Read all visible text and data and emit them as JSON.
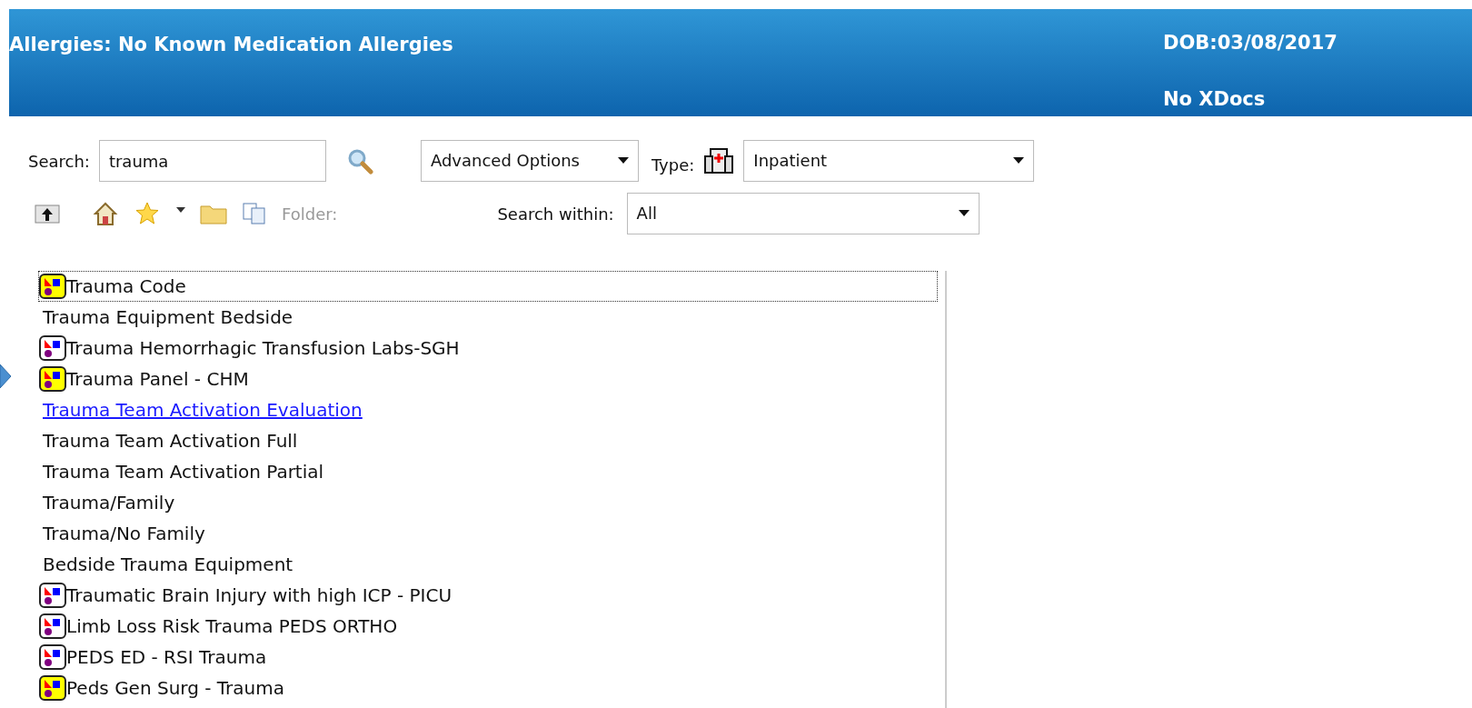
{
  "header": {
    "allergies": "Allergies: No Known Medication Allergies",
    "dob": "DOB:03/08/2017",
    "xdocs": "No XDocs"
  },
  "search": {
    "label": "Search:",
    "value": "trauma",
    "advanced": "Advanced Options",
    "type_label": "Type:",
    "type_value": "Inpatient"
  },
  "toolbar": {
    "folder_label": "Folder:",
    "search_within_label": "Search within:",
    "search_within_value": "All"
  },
  "results": [
    {
      "label": "Trauma Code",
      "kind": "plan_yellow",
      "selected": true,
      "hovered": false
    },
    {
      "label": "Trauma Equipment Bedside",
      "kind": "none",
      "selected": false,
      "hovered": false
    },
    {
      "label": "Trauma Hemorrhagic Transfusion Labs-SGH",
      "kind": "plan_white",
      "selected": false,
      "hovered": false
    },
    {
      "label": "Trauma Panel - CHM",
      "kind": "plan_yellow",
      "selected": false,
      "hovered": false
    },
    {
      "label": "Trauma Team Activation Evaluation",
      "kind": "none",
      "selected": false,
      "hovered": true
    },
    {
      "label": "Trauma Team Activation Full",
      "kind": "none",
      "selected": false,
      "hovered": false
    },
    {
      "label": "Trauma Team Activation Partial",
      "kind": "none",
      "selected": false,
      "hovered": false
    },
    {
      "label": "Trauma/Family",
      "kind": "none",
      "selected": false,
      "hovered": false
    },
    {
      "label": "Trauma/No Family",
      "kind": "none",
      "selected": false,
      "hovered": false
    },
    {
      "label": "Bedside Trauma Equipment",
      "kind": "none",
      "selected": false,
      "hovered": false
    },
    {
      "label": "Traumatic Brain Injury with high ICP - PICU",
      "kind": "plan_white",
      "selected": false,
      "hovered": false
    },
    {
      "label": "Limb Loss Risk Trauma PEDS ORTHO",
      "kind": "plan_white",
      "selected": false,
      "hovered": false
    },
    {
      "label": "PEDS ED - RSI Trauma",
      "kind": "plan_white",
      "selected": false,
      "hovered": false
    },
    {
      "label": "Peds Gen Surg - Trauma",
      "kind": "plan_yellow",
      "selected": false,
      "hovered": false
    }
  ]
}
